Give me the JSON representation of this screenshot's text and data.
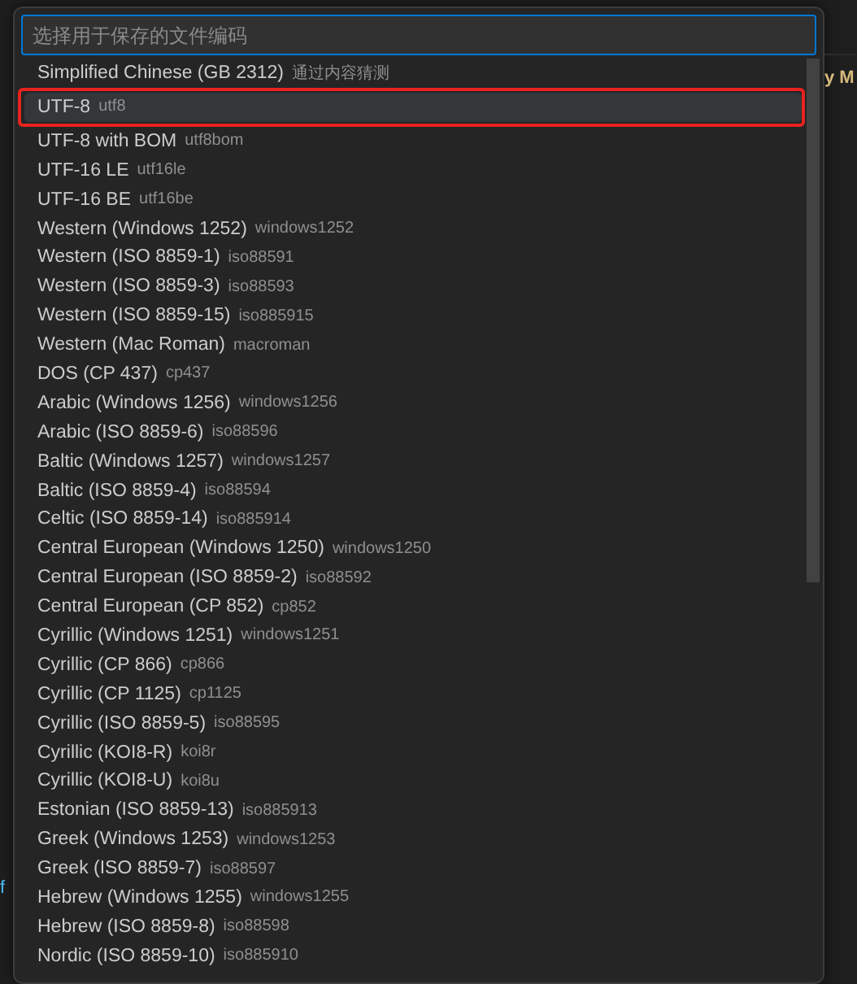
{
  "editor": {
    "left_fragment": "f",
    "right_fragment": "y M"
  },
  "quick_pick": {
    "placeholder": "选择用于保存的文件编码",
    "items": [
      {
        "label": "Simplified Chinese (GB 2312)",
        "detail": "通过内容猜测",
        "selected": false,
        "highlighted": false
      },
      {
        "label": "UTF-8",
        "detail": "utf8",
        "selected": true,
        "highlighted": true
      },
      {
        "label": "UTF-8 with BOM",
        "detail": "utf8bom",
        "selected": false,
        "highlighted": false
      },
      {
        "label": "UTF-16 LE",
        "detail": "utf16le",
        "selected": false,
        "highlighted": false
      },
      {
        "label": "UTF-16 BE",
        "detail": "utf16be",
        "selected": false,
        "highlighted": false
      },
      {
        "label": "Western (Windows 1252)",
        "detail": "windows1252",
        "selected": false,
        "highlighted": false
      },
      {
        "label": "Western (ISO 8859-1)",
        "detail": "iso88591",
        "selected": false,
        "highlighted": false
      },
      {
        "label": "Western (ISO 8859-3)",
        "detail": "iso88593",
        "selected": false,
        "highlighted": false
      },
      {
        "label": "Western (ISO 8859-15)",
        "detail": "iso885915",
        "selected": false,
        "highlighted": false
      },
      {
        "label": "Western (Mac Roman)",
        "detail": "macroman",
        "selected": false,
        "highlighted": false
      },
      {
        "label": "DOS (CP 437)",
        "detail": "cp437",
        "selected": false,
        "highlighted": false
      },
      {
        "label": "Arabic (Windows 1256)",
        "detail": "windows1256",
        "selected": false,
        "highlighted": false
      },
      {
        "label": "Arabic (ISO 8859-6)",
        "detail": "iso88596",
        "selected": false,
        "highlighted": false
      },
      {
        "label": "Baltic (Windows 1257)",
        "detail": "windows1257",
        "selected": false,
        "highlighted": false
      },
      {
        "label": "Baltic (ISO 8859-4)",
        "detail": "iso88594",
        "selected": false,
        "highlighted": false
      },
      {
        "label": "Celtic (ISO 8859-14)",
        "detail": "iso885914",
        "selected": false,
        "highlighted": false
      },
      {
        "label": "Central European (Windows 1250)",
        "detail": "windows1250",
        "selected": false,
        "highlighted": false
      },
      {
        "label": "Central European (ISO 8859-2)",
        "detail": "iso88592",
        "selected": false,
        "highlighted": false
      },
      {
        "label": "Central European (CP 852)",
        "detail": "cp852",
        "selected": false,
        "highlighted": false
      },
      {
        "label": "Cyrillic (Windows 1251)",
        "detail": "windows1251",
        "selected": false,
        "highlighted": false
      },
      {
        "label": "Cyrillic (CP 866)",
        "detail": "cp866",
        "selected": false,
        "highlighted": false
      },
      {
        "label": "Cyrillic (CP 1125)",
        "detail": "cp1125",
        "selected": false,
        "highlighted": false
      },
      {
        "label": "Cyrillic (ISO 8859-5)",
        "detail": "iso88595",
        "selected": false,
        "highlighted": false
      },
      {
        "label": "Cyrillic (KOI8-R)",
        "detail": "koi8r",
        "selected": false,
        "highlighted": false
      },
      {
        "label": "Cyrillic (KOI8-U)",
        "detail": "koi8u",
        "selected": false,
        "highlighted": false
      },
      {
        "label": "Estonian (ISO 8859-13)",
        "detail": "iso885913",
        "selected": false,
        "highlighted": false
      },
      {
        "label": "Greek (Windows 1253)",
        "detail": "windows1253",
        "selected": false,
        "highlighted": false
      },
      {
        "label": "Greek (ISO 8859-7)",
        "detail": "iso88597",
        "selected": false,
        "highlighted": false
      },
      {
        "label": "Hebrew (Windows 1255)",
        "detail": "windows1255",
        "selected": false,
        "highlighted": false
      },
      {
        "label": "Hebrew (ISO 8859-8)",
        "detail": "iso88598",
        "selected": false,
        "highlighted": false
      },
      {
        "label": "Nordic (ISO 8859-10)",
        "detail": "iso885910",
        "selected": false,
        "highlighted": false
      }
    ]
  }
}
